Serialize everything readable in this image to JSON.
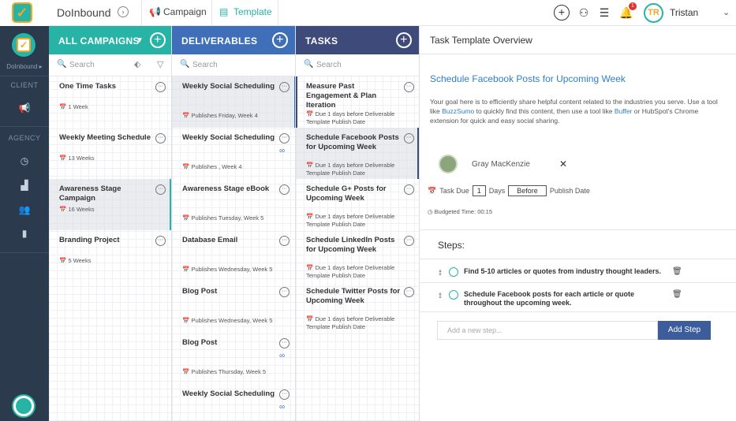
{
  "topbar": {
    "brand": "DoInbound",
    "tabs": [
      {
        "label": "Campaign"
      },
      {
        "label": "Template"
      }
    ],
    "user_initials": "TR",
    "user_name": "Tristan",
    "notification_count": "1"
  },
  "rail": {
    "workspace_name": "DoInbound ▸",
    "section_client": "CLIENT",
    "section_agency": "AGENCY"
  },
  "campaigns": {
    "header": "ALL CAMPAIGNS",
    "search_placeholder": "Search",
    "items": [
      {
        "title": "One Time Tasks",
        "meta": "1 Week"
      },
      {
        "title": "Weekly Meeting Schedule",
        "meta": "13 Weeks"
      },
      {
        "title": "Awareness Stage Campaign",
        "meta": "16 Weeks"
      },
      {
        "title": "Branding Project",
        "meta": "5 Weeks"
      }
    ]
  },
  "deliverables": {
    "header": "DELIVERABLES",
    "search_placeholder": "Search",
    "items": [
      {
        "title": "Weekly Social Scheduling",
        "meta": "Publishes Friday, Week 4"
      },
      {
        "title": "Weekly Social Scheduling",
        "meta": "Publishes , Week 4"
      },
      {
        "title": "Awareness Stage eBook",
        "meta": "Publishes Tuesday, Week 5"
      },
      {
        "title": "Database Email",
        "meta": "Publishes Wednesday, Week 5"
      },
      {
        "title": "Blog Post",
        "meta": "Publishes Wednesday, Week 5"
      },
      {
        "title": "Blog Post",
        "meta": "Publishes Thursday, Week 5"
      },
      {
        "title": "Weekly Social Scheduling",
        "meta": ""
      }
    ]
  },
  "tasks": {
    "header": "TASKS",
    "search_placeholder": "Search",
    "items": [
      {
        "title": "Measure Past Engagement & Plan Iteration",
        "meta1": "Due 1 days before Deliverable",
        "meta2": "Template Publish Date"
      },
      {
        "title": "Schedule Facebook Posts for Upcoming Week",
        "meta1": "Due 1 days before Deliverable",
        "meta2": "Template Publish Date"
      },
      {
        "title": "Schedule G+ Posts for Upcoming Week",
        "meta1": "Due 1 days before Deliverable",
        "meta2": "Template Publish Date"
      },
      {
        "title": "Schedule LinkedIn Posts for Upcoming Week",
        "meta1": "Due 1 days before Deliverable",
        "meta2": "Template Publish Date"
      },
      {
        "title": "Schedule Twitter Posts for Upcoming Week",
        "meta1": "Due 1 days before Deliverable",
        "meta2": "Template Publish Date"
      }
    ]
  },
  "panel": {
    "header": "Task Template Overview",
    "title": "Schedule Facebook Posts for Upcoming Week",
    "desc_1": "Your goal here is to efficiently share helpful content related to the industries you serve. Use a tool like ",
    "desc_link1": "BuzzSumo",
    "desc_2": " to quickly find this content, then use a tool like ",
    "desc_link2": "Buffer",
    "desc_3": " or HubSpot's Chrome extension for quick and easy social sharing.",
    "assignee": "Gray MacKenzie",
    "due_label": "Task Due",
    "due_days": "1",
    "days_label": "Days",
    "before": "Before",
    "publish_date": "Publish Date",
    "budgeted": "Budgeted Time:  00:15",
    "steps_label": "Steps:",
    "steps": [
      {
        "text": "Find 5-10 articles or quotes from industry thought leaders."
      },
      {
        "text": "Schedule Facebook posts for each article or quote throughout the upcoming week."
      }
    ],
    "new_step_placeholder": "Add a new step...",
    "add_step_label": "Add Step"
  },
  "colors": {
    "campaigns_header": "#27b3a6",
    "deliverables_header": "#3f6fb8",
    "tasks_header": "#3d4a7a",
    "rail": "#2b3a4c"
  }
}
